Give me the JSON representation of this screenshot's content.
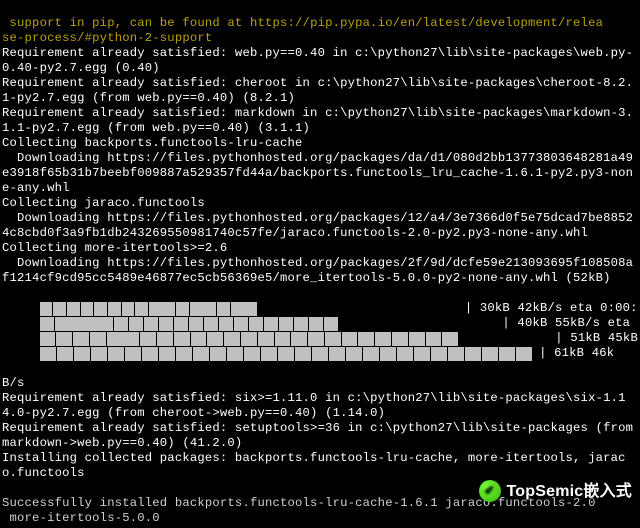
{
  "warn1": " support in pip, can be found at https://pip.pypa.io/en/latest/development/relea",
  "warn2": "se-process/#python-2-support",
  "lines_a": [
    "Requirement already satisfied: web.py==0.40 in c:\\python27\\lib\\site-packages\\web.py-0.40-py2.7.egg (0.40)",
    "Requirement already satisfied: cheroot in c:\\python27\\lib\\site-packages\\cheroot-8.2.1-py2.7.egg (from web.py==0.40) (8.2.1)",
    "Requirement already satisfied: markdown in c:\\python27\\lib\\site-packages\\markdown-3.1.1-py2.7.egg (from web.py==0.40) (3.1.1)",
    "Collecting backports.functools-lru-cache",
    "  Downloading https://files.pythonhosted.org/packages/da/d1/080d2bb13773803648281a49e3918f65b31b7beebf009887a529357fd44a/backports.functools_lru_cache-1.6.1-py2.py3-none-any.whl",
    "Collecting jaraco.functools",
    "  Downloading https://files.pythonhosted.org/packages/12/a4/3e7366d0f5e75dcad7be88524c8cbd0f3a9fb1db243269550981740c57fe/jaraco.functools-2.0-py2.py3-none-any.whl",
    "Collecting more-itertools>=2.6",
    "  Downloading https://files.pythonhosted.org/packages/2f/9d/dcfe59e213093695f108508af1214cf9cd95cc5489e46877ec5cb56369e5/more_itertools-5.0.0-py2-none-any.whl (52kB)"
  ],
  "progress": [
    {
      "bars": [
        1,
        1,
        1,
        1,
        1,
        1,
        1,
        1,
        1,
        1,
        1,
        1,
        1,
        1,
        1,
        1,
        0,
        0,
        0,
        0,
        0,
        0,
        0,
        0,
        0,
        0,
        0,
        0,
        0
      ],
      "text": "    | 30kB 42kB/s eta 0:00:"
    },
    {
      "bars": [
        1,
        1,
        1,
        1,
        1,
        1,
        1,
        1,
        1,
        1,
        1,
        1,
        1,
        1,
        1,
        1,
        1,
        1,
        1,
        1,
        0,
        0,
        0,
        0,
        0,
        0,
        0,
        0,
        0
      ],
      "text": "    | 40kB 55kB/s eta "
    },
    {
      "bars": [
        1,
        1,
        1,
        1,
        1,
        1,
        1,
        1,
        1,
        1,
        1,
        1,
        1,
        1,
        1,
        1,
        1,
        1,
        1,
        1,
        1,
        1,
        1,
        1,
        1,
        0,
        0,
        0,
        0
      ],
      "text": "    | 51kB 45kB"
    },
    {
      "bars": [
        1,
        1,
        1,
        1,
        1,
        1,
        1,
        1,
        1,
        1,
        1,
        1,
        1,
        1,
        1,
        1,
        1,
        1,
        1,
        1,
        1,
        1,
        1,
        1,
        1,
        1,
        1,
        1,
        1
      ],
      "text": " | 61kB 46k"
    }
  ],
  "bs": "B/s",
  "lines_b": [
    "Requirement already satisfied: six>=1.11.0 in c:\\python27\\lib\\site-packages\\six-1.14.0-py2.7.egg (from cheroot->web.py==0.40) (1.14.0)",
    "Requirement already satisfied: setuptools>=36 in c:\\python27\\lib\\site-packages (from markdown->web.py==0.40) (41.2.0)",
    "Installing collected packages: backports.functools-lru-cache, more-itertools, jaraco.functools"
  ],
  "done1": "Successfully installed backports.functools-lru-cache-1.6.1 jaraco.functools-2.0",
  "done2": " more-itertools-5.0.0",
  "watermark": "TopSemic嵌入式"
}
